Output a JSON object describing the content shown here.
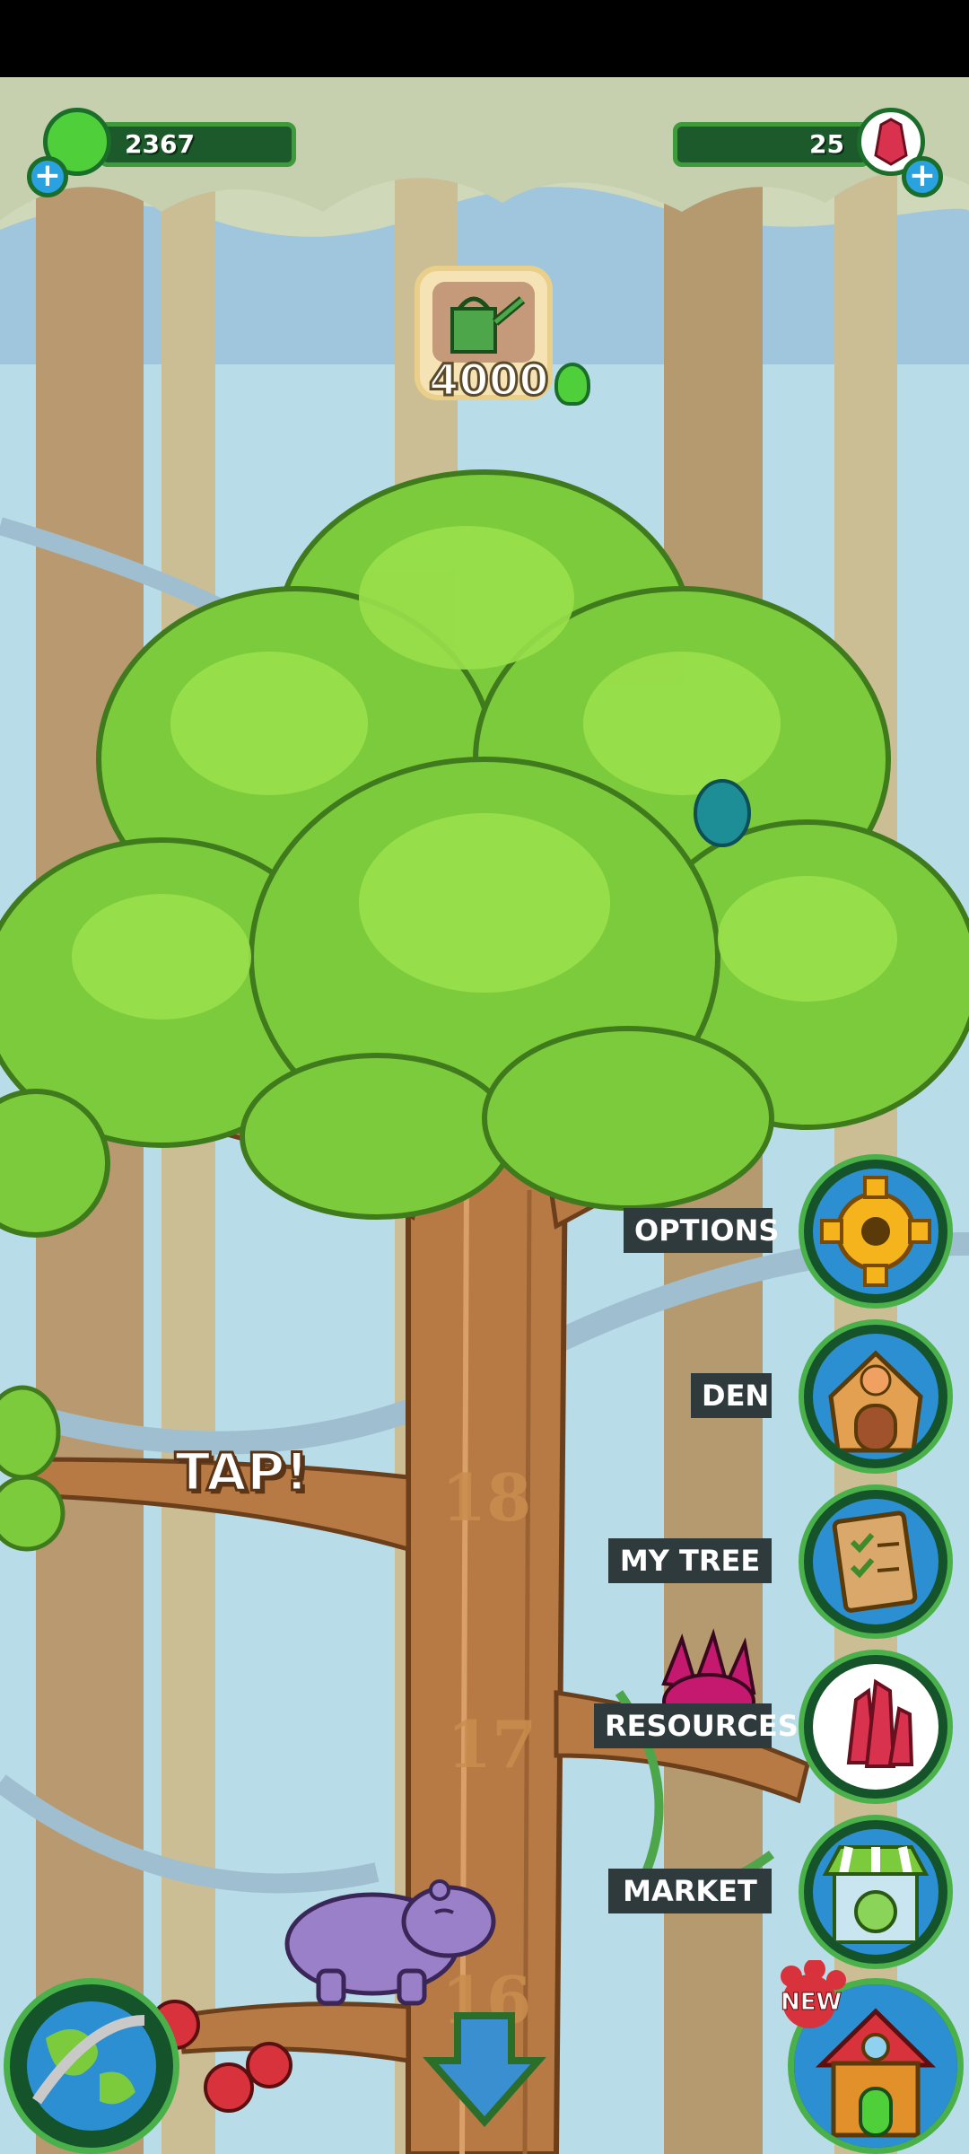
{
  "currency": {
    "jelly": {
      "value": "2367",
      "color": "#4fd03b"
    },
    "gems": {
      "value": "25",
      "color": "#d8324e"
    }
  },
  "upgrade": {
    "icon": "watering-can-icon",
    "cost": "4000"
  },
  "tree": {
    "tap_label": "TAP!",
    "level_markers": [
      "18",
      "17",
      "16"
    ]
  },
  "menu": [
    {
      "label": "OPTIONS",
      "icon": "gear-icon"
    },
    {
      "label": "DEN",
      "icon": "den-house-icon"
    },
    {
      "label": "MY TREE",
      "icon": "checklist-board-icon"
    },
    {
      "label": "RESOURCES",
      "icon": "crystal-icon"
    },
    {
      "label": "MARKET",
      "icon": "market-stall-icon"
    }
  ],
  "bottom": {
    "left_icon": "globe-icon",
    "center_icon": "down-arrow-icon",
    "right_icon": "house-icon",
    "badge": "NEW"
  },
  "colors": {
    "leaf": "#7ccb3c",
    "trunk": "#b87a44",
    "sky": "#bfe0ea"
  }
}
